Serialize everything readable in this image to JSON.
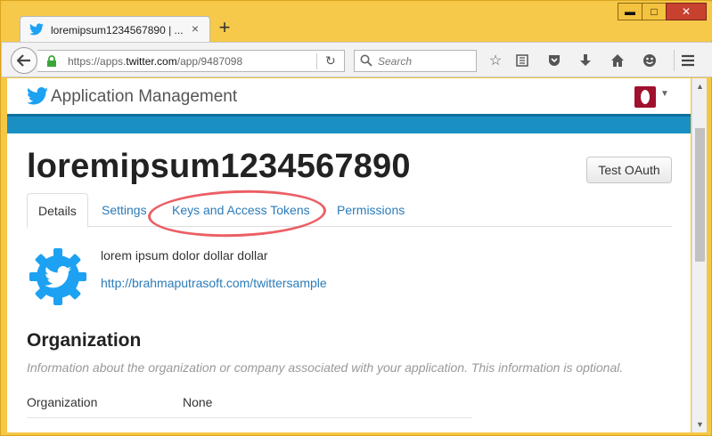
{
  "browser": {
    "tab_title": "loremipsum1234567890 | ...",
    "tab_close": "×",
    "new_tab": "+",
    "url_prefix": "https://apps.",
    "url_domain": "twitter.com",
    "url_path": "/app/9487098",
    "search_placeholder": "Search",
    "window_buttons": {
      "minimize": "▬",
      "maximize": "□",
      "close": "✕"
    }
  },
  "site": {
    "header_title": "Application Management"
  },
  "app": {
    "title": "loremipsum1234567890",
    "test_oauth_label": "Test OAuth",
    "tabs": [
      {
        "label": "Details"
      },
      {
        "label": "Settings"
      },
      {
        "label": "Keys and Access Tokens"
      },
      {
        "label": "Permissions"
      }
    ],
    "description": "lorem ipsum dolor dollar dollar",
    "website": "http://brahmaputrasoft.com/twittersample"
  },
  "organization": {
    "heading": "Organization",
    "subtitle": "Information about the organization or company associated with your application. This information is optional.",
    "rows": [
      {
        "label": "Organization",
        "value": "None"
      }
    ]
  },
  "colors": {
    "twitter_blue": "#1da1f2",
    "band_blue": "#1a8fc4",
    "link_blue": "#2b7bb9",
    "highlight_red": "#e8434a",
    "titlebar_yellow": "#f6c94b"
  },
  "icons": {
    "tab": "twitter-bird-icon",
    "back": "back-arrow-icon",
    "lock": "lock-icon",
    "reload": "reload-icon",
    "search": "search-icon",
    "toolbar": [
      "bookmark-star-icon",
      "reading-list-icon",
      "pocket-icon",
      "download-icon",
      "home-icon",
      "emoji-icon",
      "menu-icon"
    ]
  }
}
